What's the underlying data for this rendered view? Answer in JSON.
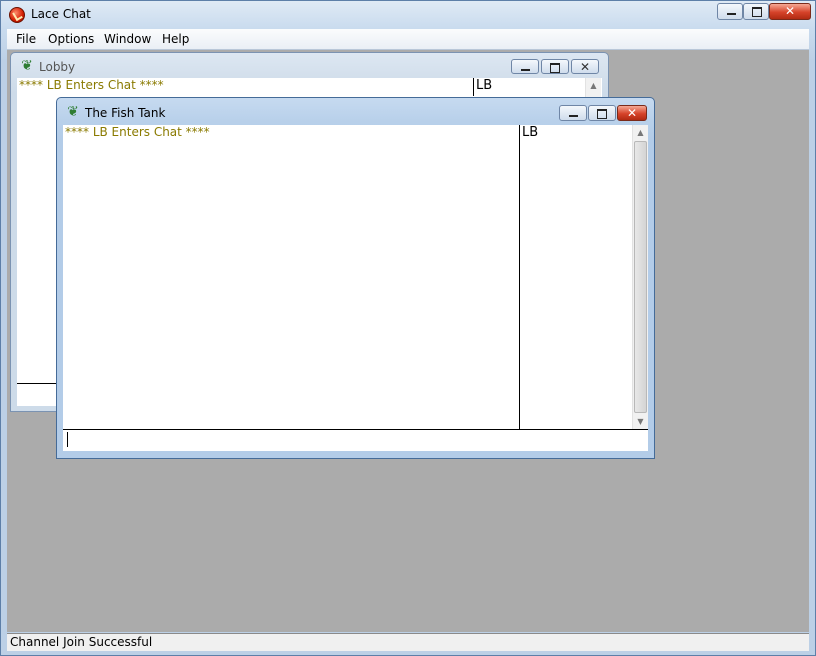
{
  "app": {
    "title": "Lace Chat",
    "icon": "lace-app-icon"
  },
  "menu": {
    "items": [
      "File",
      "Options",
      "Window",
      "Help"
    ]
  },
  "windows": {
    "lobby": {
      "title": "Lobby",
      "icon": "leaf-icon",
      "messages": [
        "**** LB Enters Chat ****"
      ],
      "users": [
        "LB"
      ]
    },
    "fish_tank": {
      "title": "The Fish Tank",
      "icon": "leaf-icon",
      "messages": [
        "**** LB Enters Chat ****"
      ],
      "users": [
        "LB"
      ],
      "input_value": ""
    }
  },
  "status": {
    "text": "Channel Join Successful"
  },
  "colors": {
    "system_message": "#8a7a00",
    "mdi_background": "#ababab",
    "close_button": "#d6432a"
  }
}
